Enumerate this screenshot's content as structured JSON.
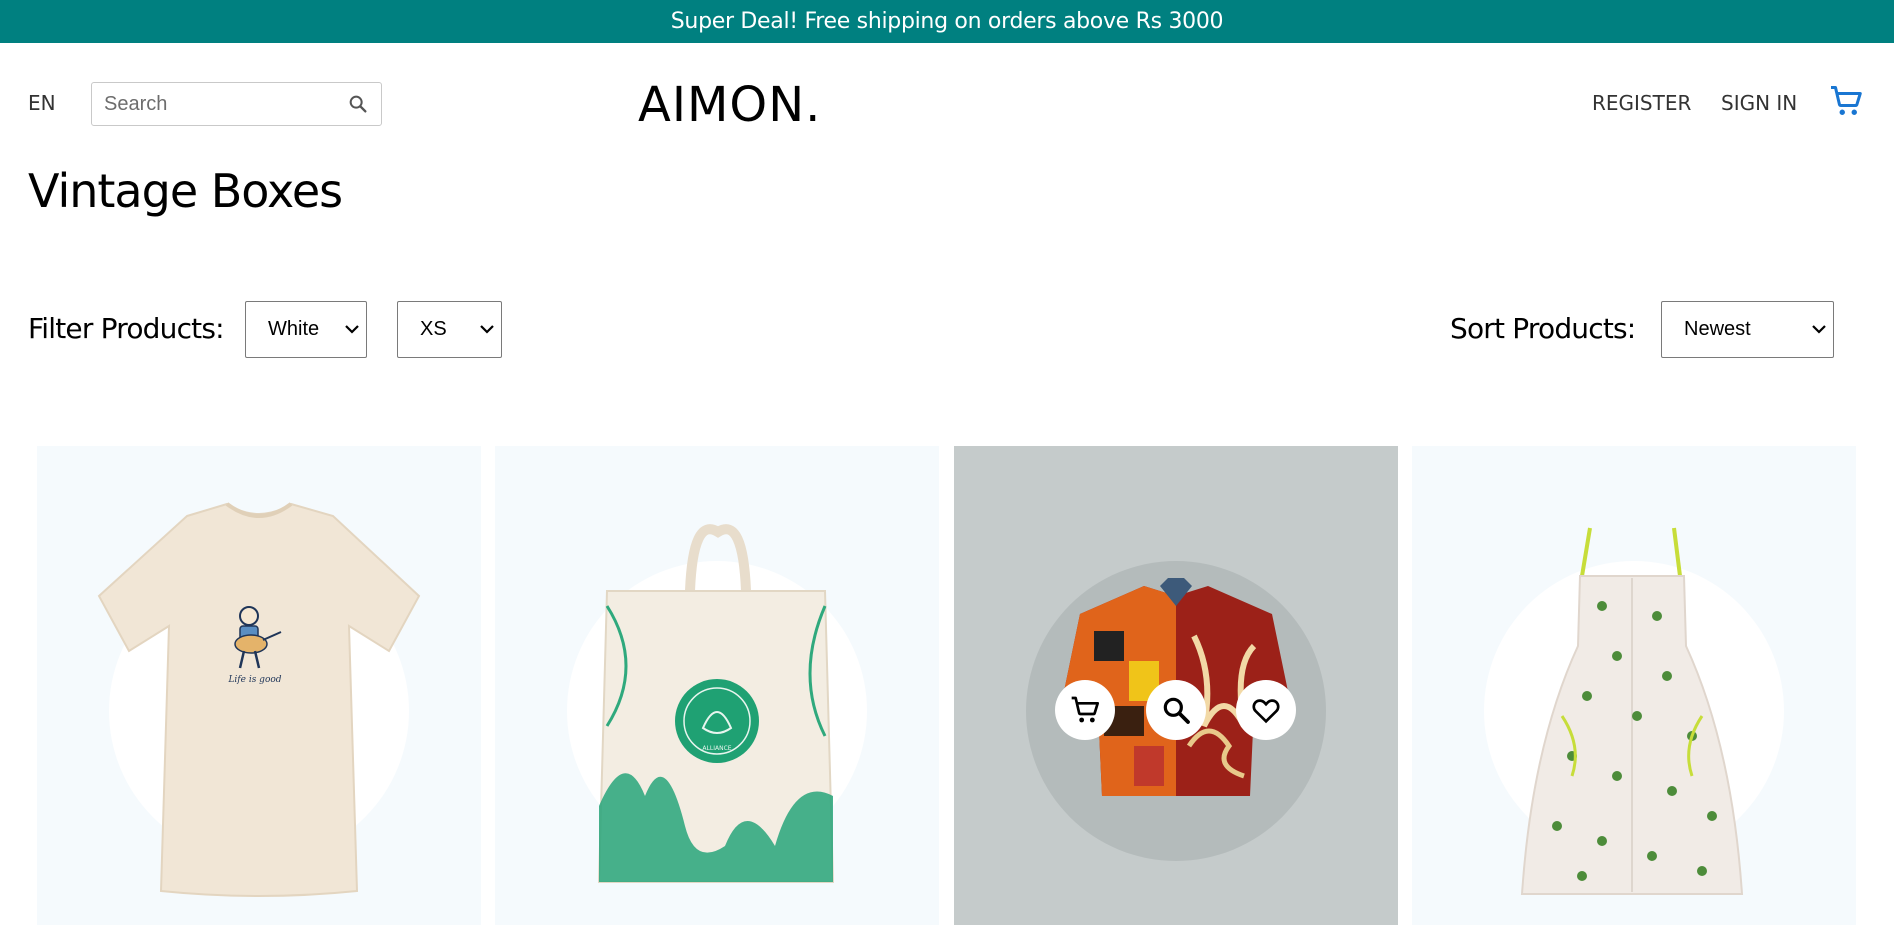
{
  "announcement": "Super Deal! Free shipping on orders above Rs 3000",
  "header": {
    "language": "EN",
    "search_placeholder": "Search",
    "logo": "AIMON.",
    "register": "REGISTER",
    "sign_in": "SIGN IN",
    "cart_icon": "cart-icon",
    "accent_color": "#1976d2"
  },
  "page": {
    "title": "Vintage Boxes"
  },
  "filters": {
    "label": "Filter Products:",
    "color_selected": "White",
    "size_selected": "XS"
  },
  "sort": {
    "label": "Sort Products:",
    "selected": "Newest"
  },
  "brand_color": "#008080",
  "products": [
    {
      "image": "t-shirt",
      "print_text": "Life is good"
    },
    {
      "image": "tote-bag",
      "badge_text": "ALLIANCE"
    },
    {
      "image": "shirt",
      "actions": [
        "cart-icon",
        "search-icon",
        "heart-icon"
      ]
    },
    {
      "image": "dress"
    }
  ]
}
